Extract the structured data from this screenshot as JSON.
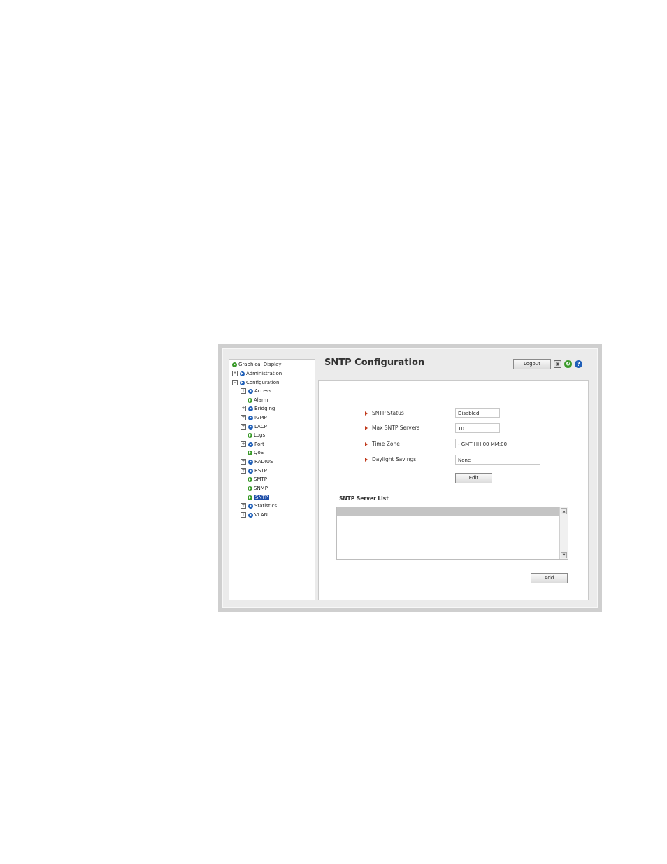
{
  "page": {
    "title": "SNTP Configuration",
    "logout_label": "Logout"
  },
  "icons": {
    "save": "save-icon",
    "refresh": "refresh-icon",
    "help": "help-icon"
  },
  "colors": {
    "tree_bullet_green": "#3a9a2a",
    "tree_bullet_blue": "#1f5fb8",
    "selected_highlight": "#1f4fa8",
    "field_arrow": "#c0391b"
  },
  "sidebar": {
    "items": [
      {
        "label": "Graphical Display",
        "expander": "",
        "bullet": "green"
      },
      {
        "label": "Administration",
        "expander": "+",
        "bullet": "blue"
      },
      {
        "label": "Configuration",
        "expander": "-",
        "bullet": "blue"
      },
      {
        "label": "Access",
        "expander": "+",
        "bullet": "blue"
      },
      {
        "label": "Alarm",
        "expander": "",
        "bullet": "green"
      },
      {
        "label": "Bridging",
        "expander": "+",
        "bullet": "blue"
      },
      {
        "label": "IGMP",
        "expander": "+",
        "bullet": "blue"
      },
      {
        "label": "LACP",
        "expander": "+",
        "bullet": "blue"
      },
      {
        "label": "Logs",
        "expander": "",
        "bullet": "green"
      },
      {
        "label": "Port",
        "expander": "+",
        "bullet": "blue"
      },
      {
        "label": "QoS",
        "expander": "",
        "bullet": "green"
      },
      {
        "label": "RADIUS",
        "expander": "+",
        "bullet": "blue"
      },
      {
        "label": "RSTP",
        "expander": "+",
        "bullet": "blue"
      },
      {
        "label": "SMTP",
        "expander": "",
        "bullet": "green"
      },
      {
        "label": "SNMP",
        "expander": "",
        "bullet": "green"
      },
      {
        "label": "SNTP",
        "expander": "",
        "bullet": "green",
        "selected": true
      },
      {
        "label": "Statistics",
        "expander": "+",
        "bullet": "blue"
      },
      {
        "label": "VLAN",
        "expander": "+",
        "bullet": "blue"
      }
    ]
  },
  "form": {
    "sntp_status": {
      "label": "SNTP Status",
      "value": "Disabled"
    },
    "max_servers": {
      "label": "Max SNTP Servers",
      "value": "10"
    },
    "time_zone": {
      "label": "Time Zone",
      "value": "- GMT HH:00 MM:00"
    },
    "daylight_savings": {
      "label": "Daylight Savings",
      "value": "None"
    },
    "edit_label": "Edit"
  },
  "server_list": {
    "heading": "SNTP Server List",
    "add_label": "Add"
  }
}
